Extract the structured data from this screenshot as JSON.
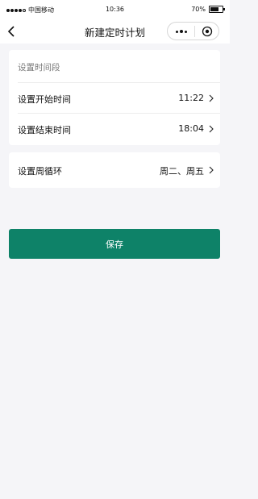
{
  "status_bar": {
    "carrier": "中国移动",
    "time": "10:36",
    "battery": "70%",
    "battery_level": 0.7
  },
  "navbar": {
    "title": "新建定时计划",
    "back_icon": "chevron-left-icon",
    "more_icon": "more-dots-icon",
    "close_icon": "target-close-icon"
  },
  "time_section": {
    "label": "设置时间段",
    "start": {
      "label": "设置开始时间",
      "value": "11:22"
    },
    "end": {
      "label": "设置结束时间",
      "value": "18:04"
    }
  },
  "cycle": {
    "label": "设置周循环",
    "value": "周二、周五"
  },
  "save_button": {
    "label": "保存"
  },
  "colors": {
    "accent": "#0e8268",
    "background": "#f5f5f8",
    "card": "#ffffff"
  }
}
